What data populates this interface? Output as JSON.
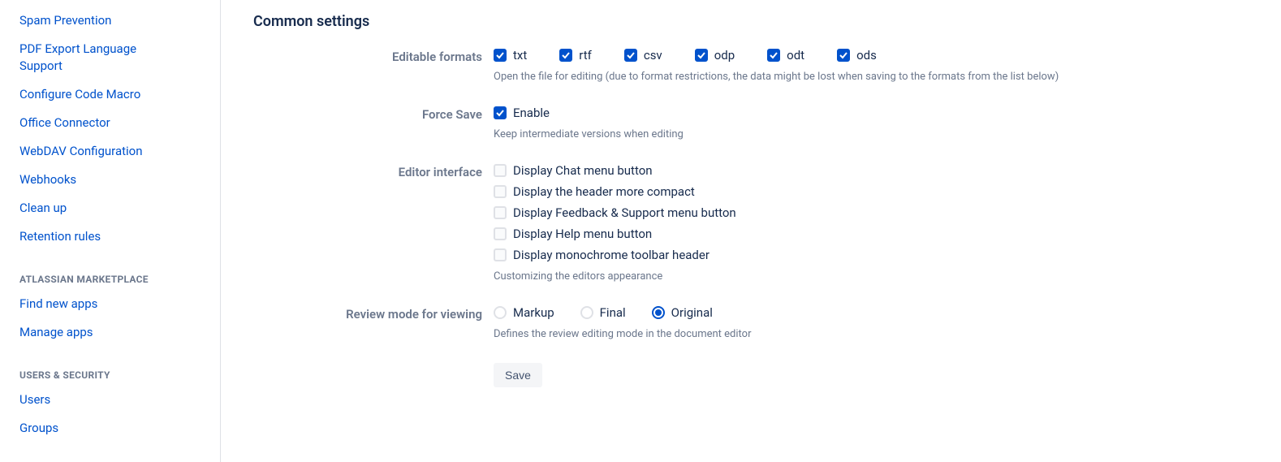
{
  "sidebar": {
    "group1": [
      "Spam Prevention",
      "PDF Export Language Support",
      "Configure Code Macro",
      "Office Connector",
      "WebDAV Configuration",
      "Webhooks",
      "Clean up",
      "Retention rules"
    ],
    "heading2": "ATLASSIAN MARKETPLACE",
    "group2": [
      "Find new apps",
      "Manage apps"
    ],
    "heading3": "USERS & SECURITY",
    "group3": [
      "Users",
      "Groups"
    ]
  },
  "page": {
    "title": "Common settings",
    "editable_formats": {
      "label": "Editable formats",
      "options": [
        {
          "label": "txt",
          "checked": true
        },
        {
          "label": "rtf",
          "checked": true
        },
        {
          "label": "csv",
          "checked": true
        },
        {
          "label": "odp",
          "checked": true
        },
        {
          "label": "odt",
          "checked": true
        },
        {
          "label": "ods",
          "checked": true
        }
      ],
      "help": "Open the file for editing (due to format restrictions, the data might be lost when saving to the formats from the list below)"
    },
    "force_save": {
      "label": "Force Save",
      "option_label": "Enable",
      "checked": true,
      "help": "Keep intermediate versions when editing"
    },
    "editor_interface": {
      "label": "Editor interface",
      "options": [
        {
          "label": "Display Chat menu button",
          "checked": false
        },
        {
          "label": "Display the header more compact",
          "checked": false
        },
        {
          "label": "Display Feedback & Support menu button",
          "checked": false
        },
        {
          "label": "Display Help menu button",
          "checked": false
        },
        {
          "label": "Display monochrome toolbar header",
          "checked": false
        }
      ],
      "help": "Customizing the editors appearance"
    },
    "review_mode": {
      "label": "Review mode for viewing",
      "options": [
        {
          "label": "Markup",
          "checked": false
        },
        {
          "label": "Final",
          "checked": false
        },
        {
          "label": "Original",
          "checked": true
        }
      ],
      "help": "Defines the review editing mode in the document editor"
    },
    "save_button": "Save"
  }
}
